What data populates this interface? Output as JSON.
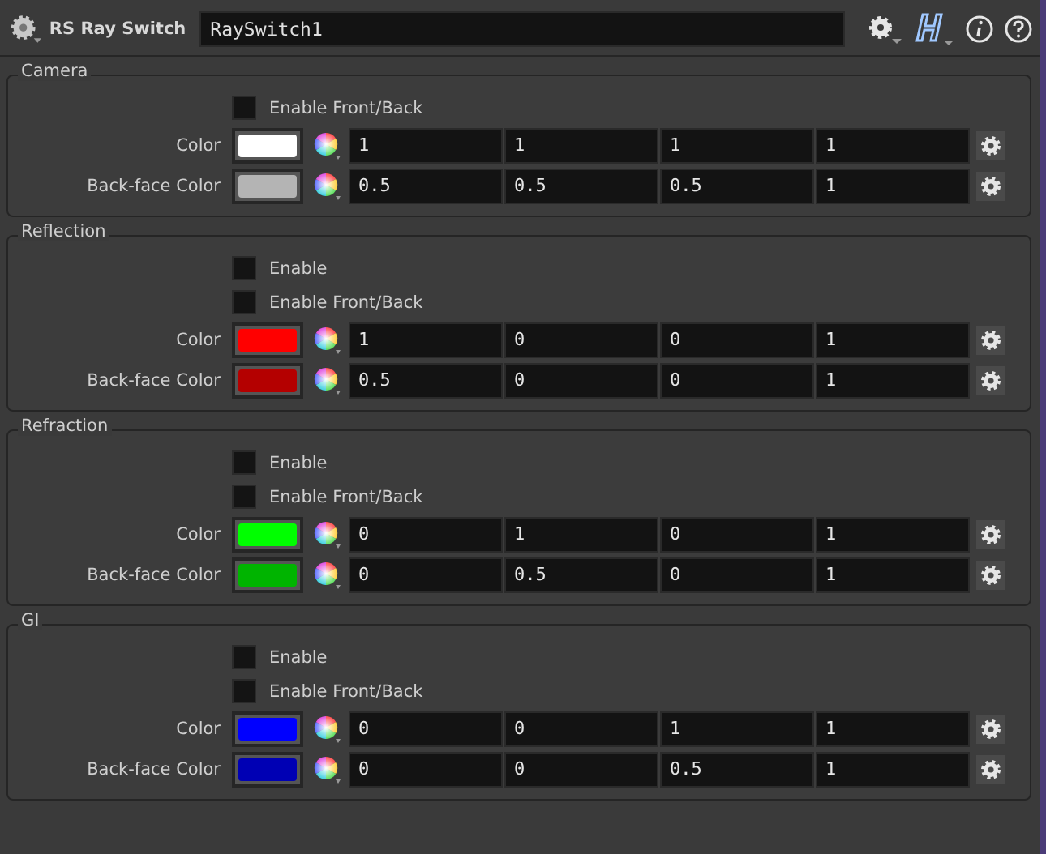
{
  "node": {
    "type_label": "RS Ray Switch",
    "name": "RaySwitch1"
  },
  "sections": [
    {
      "title": "Camera",
      "toggles": [
        {
          "label": "Enable Front/Back",
          "checked": false
        }
      ],
      "colors": [
        {
          "label": "Color",
          "color": "#ffffff",
          "values": [
            "1",
            "1",
            "1",
            "1"
          ]
        },
        {
          "label": "Back-face Color",
          "color": "#b4b4b4",
          "values": [
            "0.5",
            "0.5",
            "0.5",
            "1"
          ]
        }
      ]
    },
    {
      "title": "Reflection",
      "toggles": [
        {
          "label": "Enable",
          "checked": false
        },
        {
          "label": "Enable Front/Back",
          "checked": false
        }
      ],
      "colors": [
        {
          "label": "Color",
          "color": "#ff0000",
          "values": [
            "1",
            "0",
            "0",
            "1"
          ]
        },
        {
          "label": "Back-face Color",
          "color": "#b40000",
          "values": [
            "0.5",
            "0",
            "0",
            "1"
          ]
        }
      ]
    },
    {
      "title": "Refraction",
      "toggles": [
        {
          "label": "Enable",
          "checked": false
        },
        {
          "label": "Enable Front/Back",
          "checked": false
        }
      ],
      "colors": [
        {
          "label": "Color",
          "color": "#00ff00",
          "values": [
            "0",
            "1",
            "0",
            "1"
          ]
        },
        {
          "label": "Back-face Color",
          "color": "#00b400",
          "values": [
            "0",
            "0.5",
            "0",
            "1"
          ]
        }
      ]
    },
    {
      "title": "GI",
      "toggles": [
        {
          "label": "Enable",
          "checked": false
        },
        {
          "label": "Enable Front/Back",
          "checked": false
        }
      ],
      "colors": [
        {
          "label": "Color",
          "color": "#0000ff",
          "values": [
            "0",
            "0",
            "1",
            "1"
          ]
        },
        {
          "label": "Back-face Color",
          "color": "#0000b4",
          "values": [
            "0",
            "0",
            "0.5",
            "1"
          ]
        }
      ]
    }
  ]
}
